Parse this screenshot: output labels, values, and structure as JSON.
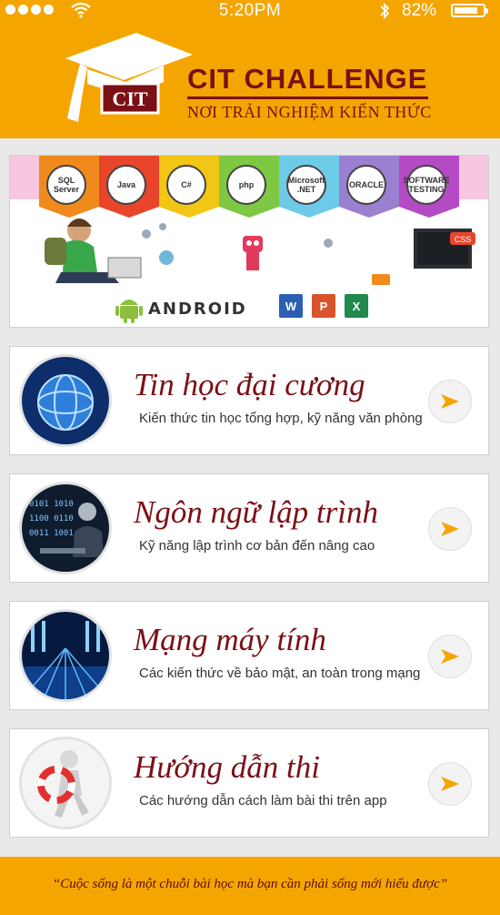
{
  "status_bar": {
    "time": "5:20PM",
    "battery_percent": "82%",
    "battery_level": 0.82,
    "signal_dots": 4,
    "icons": [
      "wifi-icon",
      "bluetooth-icon",
      "battery-icon"
    ]
  },
  "header": {
    "logo_text": "CIT",
    "title": "CIT CHALLENGE",
    "subtitle": "NƠI TRẢI NGHIỆM KIẾN THỨC"
  },
  "banner": {
    "tech_logos": [
      "SQL Server",
      "Java",
      "C#",
      "php",
      "Microsoft .NET",
      "ORACLE",
      "SOFTWARE TESTING"
    ],
    "android_text": "ANDROID",
    "office_icons": [
      "word-icon",
      "powerpoint-icon",
      "excel-icon"
    ]
  },
  "menu": {
    "items": [
      {
        "title": "Tin học đại cương",
        "subtitle": "Kiến thức tin học tổng hợp, kỹ năng văn phòng",
        "icon": "globe-icon"
      },
      {
        "title": "Ngôn ngữ lập trình",
        "subtitle": "Kỹ năng lập trình cơ bản đến nâng cao",
        "icon": "coder-icon"
      },
      {
        "title": "Mạng máy tính",
        "subtitle": "Các kiến thức về bảo mật, an toàn trong mạng",
        "icon": "network-icon"
      },
      {
        "title": "Hướng dẫn thi",
        "subtitle": "Các hướng dẫn cách làm bài thi trên app",
        "icon": "lifebuoy-icon"
      }
    ]
  },
  "footer": {
    "quote": "“Cuộc sống là một chuỗi bài học mà bạn cần phải sống mới hiểu được”"
  },
  "colors": {
    "accent": "#f5a500",
    "brand": "#7a1016",
    "arrow": "#f5a500"
  }
}
